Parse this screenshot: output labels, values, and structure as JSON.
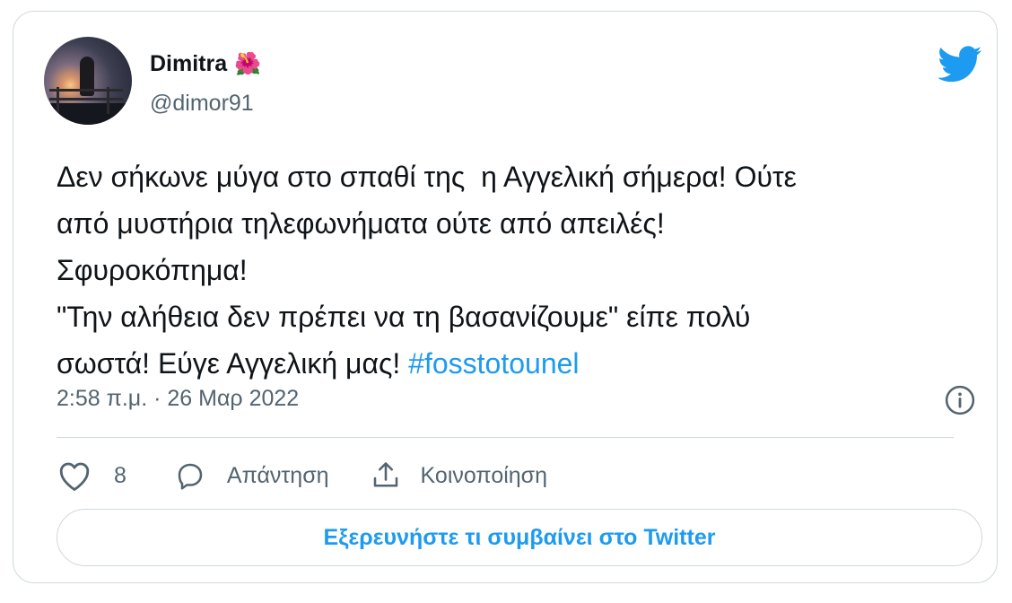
{
  "tweet": {
    "author": {
      "name": "Dimitra",
      "name_emoji": "🌺",
      "handle": "@dimor91"
    },
    "text_lines": [
      "Δεν σήκωνε μύγα στο σπαθί της  η Αγγελική σήμερα! Ούτε",
      "από μυστήρια τηλεφωνήματα ούτε από απειλές!",
      "Σφυροκόπημα!",
      "\"Την αλήθεια δεν πρέπει να τη βασανίζουμε\" είπε πολύ",
      "σωστά! Εύγε Αγγελική μας! "
    ],
    "hashtag": "#fosstotounel",
    "timestamp": "2:58 π.μ. · 26 Μαρ 2022",
    "actions": {
      "like_count": "8",
      "reply_label": "Απάντηση",
      "share_label": "Κοινοποίηση"
    },
    "explore_button": "Εξερευνήστε τι συμβαίνει στο Twitter"
  },
  "colors": {
    "accent": "#1d9bf0",
    "text": "#0f1419",
    "secondary": "#536471",
    "border": "#cfd9de"
  },
  "icons": [
    "twitter-bird-icon",
    "info-icon",
    "heart-icon",
    "reply-icon",
    "share-icon"
  ]
}
